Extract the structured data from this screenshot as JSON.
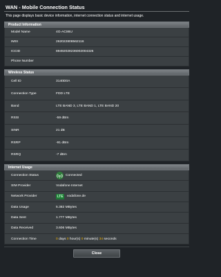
{
  "title": "WAN - Mobile Connection Status",
  "description": "This page displays basic device information, internet connection status and internet usage.",
  "product_information": {
    "header": "Product Information",
    "rows": [
      {
        "label": "Model Name",
        "value": "4G-AC86U"
      },
      {
        "label": "IMSI",
        "value": "262022808562116"
      },
      {
        "label": "ICCID",
        "value": "89492028236002004325"
      },
      {
        "label": "Phone Number",
        "value": ""
      }
    ]
  },
  "wireless_status": {
    "header": "Wireless Status",
    "rows": [
      {
        "label": "Cell ID",
        "value": "3140D0A"
      },
      {
        "label": "Connection Type",
        "value": "FDD LTE"
      },
      {
        "label": "Band",
        "value": "LTE BAND 3, LTE BAND 1, LTE BAND 20"
      },
      {
        "label": "RSSI",
        "value": "-59 dBm"
      },
      {
        "label": "SINR",
        "value": "21 dB"
      },
      {
        "label": "RSRP",
        "value": "-91 dBm"
      },
      {
        "label": "RSRQ",
        "value": "-7 dBm"
      }
    ]
  },
  "internet_usage": {
    "header": "Internet Usage",
    "connection_status": {
      "label": "Connection Status",
      "value": "Connected",
      "icon": "signal-connected-icon"
    },
    "sim_provider": {
      "label": "SIM Provider",
      "value": "Vodafone Internet"
    },
    "network_provider": {
      "label": "Network Provider",
      "badge": "LTE",
      "value": "vodafone.de"
    },
    "data_usage": {
      "label": "Data Usage",
      "value": "5.382 MBytes"
    },
    "data_sent": {
      "label": "Data Sent",
      "value": "1.777 MBytes"
    },
    "data_received": {
      "label": "Data Received",
      "value": "3.606 MBytes"
    },
    "connection_time": {
      "label": "Connection Time",
      "days": "0",
      "days_label": "days",
      "hours": "0",
      "hours_label": "hour(s)",
      "minutes": "0",
      "minutes_label": "minute(s)",
      "seconds": "34",
      "seconds_label": "seconds"
    }
  },
  "close_button": "Close",
  "colors": {
    "background": "#1f2327",
    "row_background": "#3b4043",
    "connected_green": "#2e7d3a",
    "time_number": "#f6b400"
  }
}
